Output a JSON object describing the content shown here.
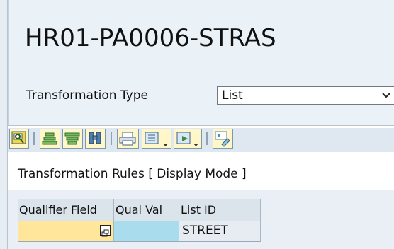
{
  "window": {
    "title": "HR01-PA0006-STRAS"
  },
  "transformation": {
    "label": "Transformation Type",
    "selected_value": "List"
  },
  "toolbar": {
    "buttons": [
      "details-icon",
      "sort-ascending-icon",
      "filter-icon",
      "find-icon",
      "print-icon",
      "layout-icon",
      "export-icon",
      "settings-icon"
    ]
  },
  "rules": {
    "caption": "Transformation Rules [ Display Mode ]",
    "columns": [
      "Qualifier Field",
      "Qual Val",
      "List ID"
    ],
    "rows": [
      {
        "qualifier_field": "",
        "qual_val": "",
        "list_id": "STREET"
      }
    ]
  },
  "colors": {
    "header_bg": "#eaf1f7",
    "toolbar_bg": "#dfe8f0",
    "qualifier_cell": "#ffe69a",
    "qual_val_cell": "#a9dced",
    "list_id_cell": "#e6ecf1"
  }
}
